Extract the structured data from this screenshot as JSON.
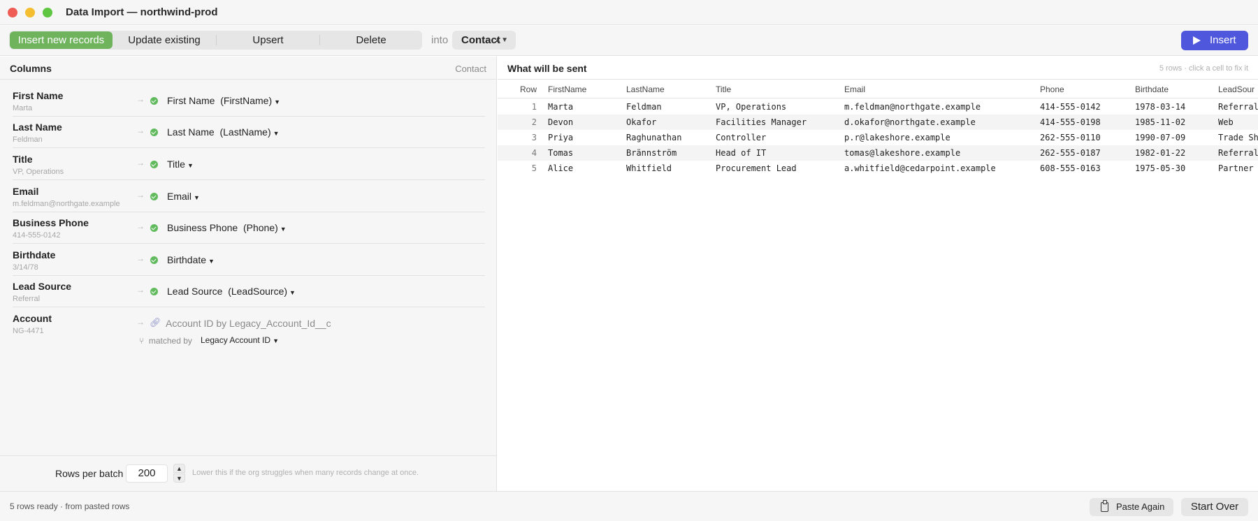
{
  "window": {
    "title": "Data Import — northwind-prod"
  },
  "toolbar": {
    "modes": [
      "Insert new records",
      "Update existing",
      "Upsert",
      "Delete"
    ],
    "into_label": "into",
    "object_select": "Contact",
    "insert_label": "Insert"
  },
  "colors": {
    "accent": "#4f57dc",
    "active_mode": "#6fb35d",
    "mapped": "#62ba5e"
  },
  "columns_pane": {
    "title": "Columns",
    "object": "Contact",
    "mappings": [
      {
        "name": "First Name",
        "sample": "Marta",
        "target": "First Name",
        "api": "(FirstName)"
      },
      {
        "name": "Last Name",
        "sample": "Feldman",
        "target": "Last Name",
        "api": "(LastName)"
      },
      {
        "name": "Title",
        "sample": "VP, Operations",
        "target": "Title",
        "api": ""
      },
      {
        "name": "Email",
        "sample": "m.feldman@northgate.example",
        "target": "Email",
        "api": ""
      },
      {
        "name": "Business Phone",
        "sample": "414-555-0142",
        "target": "Business Phone",
        "api": "(Phone)"
      },
      {
        "name": "Birthdate",
        "sample": "3/14/78",
        "target": "Birthdate",
        "api": ""
      },
      {
        "name": "Lead Source",
        "sample": "Referral",
        "target": "Lead Source",
        "api": "(LeadSource)"
      }
    ],
    "lookup": {
      "name": "Account",
      "sample": "NG-4471",
      "target": "Account ID by Legacy_Account_Id__c",
      "matched_by_label": "matched by",
      "matched_by_value": "Legacy Account ID"
    },
    "batch": {
      "label": "Rows per batch",
      "value": "200",
      "hint": "Lower this if the org struggles when many records change at once."
    }
  },
  "preview_pane": {
    "title": "What will be sent",
    "hint": "5 rows · click a cell to fix it",
    "headers": [
      "Row",
      "FirstName",
      "LastName",
      "Title",
      "Email",
      "Phone",
      "Birthdate",
      "LeadSour"
    ],
    "rows": [
      [
        "1",
        "Marta",
        "Feldman",
        "VP, Operations",
        "m.feldman@northgate.example",
        "414-555-0142",
        "1978-03-14",
        "Referral"
      ],
      [
        "2",
        "Devon",
        "Okafor",
        "Facilities Manager",
        "d.okafor@northgate.example",
        "414-555-0198",
        "1985-11-02",
        "Web"
      ],
      [
        "3",
        "Priya",
        "Raghunathan",
        "Controller",
        "p.r@lakeshore.example",
        "262-555-0110",
        "1990-07-09",
        "Trade Sh"
      ],
      [
        "4",
        "Tomas",
        "Brännström",
        "Head of IT",
        "tomas@lakeshore.example",
        "262-555-0187",
        "1982-01-22",
        "Referral"
      ],
      [
        "5",
        "Alice",
        "Whitfield",
        "Procurement Lead",
        "a.whitfield@cedarpoint.example",
        "608-555-0163",
        "1975-05-30",
        "Partner"
      ]
    ]
  },
  "footer": {
    "status": "5 rows ready · from pasted rows",
    "paste_again": "Paste Again",
    "start_over": "Start Over"
  }
}
